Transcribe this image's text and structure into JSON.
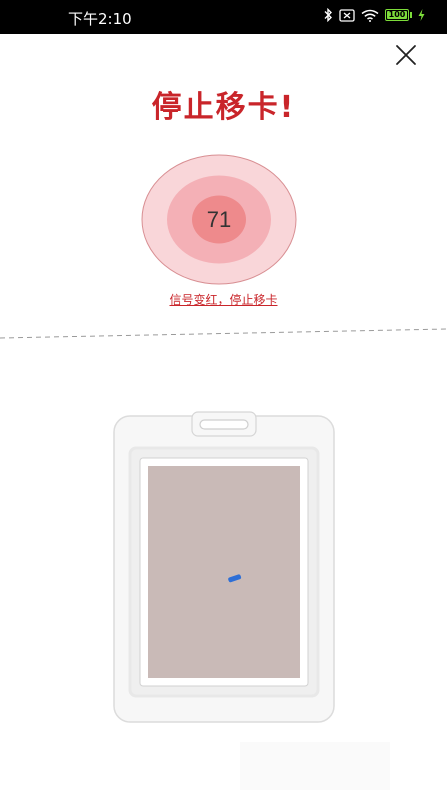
{
  "status_bar": {
    "time": "下午2:10",
    "battery": "100",
    "icons": [
      "bluetooth-icon",
      "sim-icon",
      "wifi-icon",
      "battery-icon",
      "charging-icon"
    ]
  },
  "header": {
    "close_icon": "close-icon"
  },
  "main": {
    "title": "停止移卡!",
    "signal_value": "71",
    "hint": "信号变红，停止移卡"
  },
  "colors": {
    "accent_red": "#c9252a",
    "ring_outer": "#f9d6d9",
    "ring_middle": "#f4b0b6",
    "ring_inner": "#ee8a8c",
    "card_frame": "#f7f7f7",
    "card_insert": "#c9bab7",
    "marker_blue": "#2e6fd6",
    "battery_green": "#7ddc3a"
  }
}
